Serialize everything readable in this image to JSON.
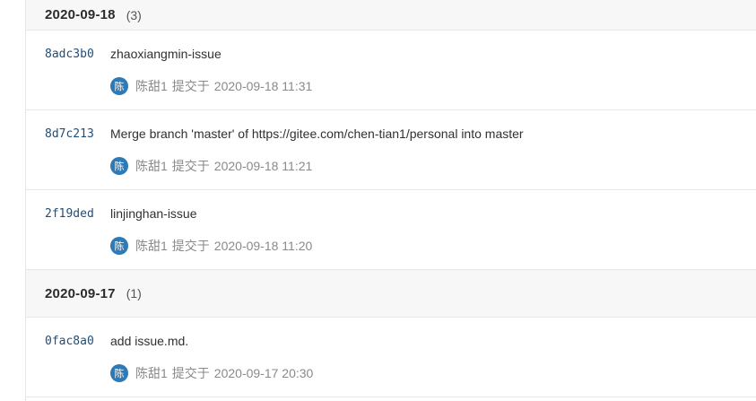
{
  "groups": [
    {
      "date": "2020-09-18",
      "count": "(3)",
      "commits": [
        {
          "sha": "8adc3b0",
          "message": "zhaoxiangmin-issue",
          "avatar": "陈",
          "author": "陈甜1",
          "action": "提交于",
          "time": "2020-09-18 11:31"
        },
        {
          "sha": "8d7c213",
          "message": "Merge branch 'master' of https://gitee.com/chen-tian1/personal into master",
          "avatar": "陈",
          "author": "陈甜1",
          "action": "提交于",
          "time": "2020-09-18 11:21"
        },
        {
          "sha": "2f19ded",
          "message": "linjinghan-issue",
          "avatar": "陈",
          "author": "陈甜1",
          "action": "提交于",
          "time": "2020-09-18 11:20"
        }
      ]
    },
    {
      "date": "2020-09-17",
      "count": "(1)",
      "commits": [
        {
          "sha": "0fac8a0",
          "message": "add issue.md.",
          "avatar": "陈",
          "author": "陈甜1",
          "action": "提交于",
          "time": "2020-09-17 20:30"
        }
      ]
    }
  ],
  "colors": {
    "sha": "#1f4d7a",
    "avatar_bg": "#2e7ab6",
    "header_bg": "#f7f7f8"
  }
}
